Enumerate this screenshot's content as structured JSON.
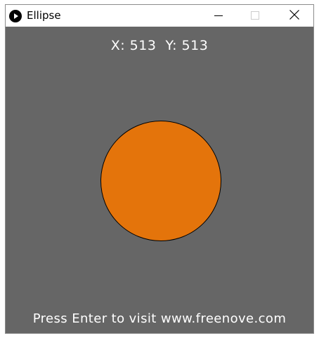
{
  "window": {
    "title": "Ellipse",
    "app_icon": "play-circle-icon",
    "controls": {
      "minimize_icon": "minimize-icon",
      "maximize_icon": "maximize-icon",
      "close_icon": "close-icon"
    }
  },
  "canvas": {
    "background_color": "#666666",
    "coordinates": {
      "x_label": "X:",
      "x_value": "513",
      "y_label": "Y:",
      "y_value": "513"
    },
    "ellipse": {
      "fill_color": "#e4740b",
      "stroke_color": "#000000"
    },
    "footer_text": "Press Enter to visit www.freenove.com"
  }
}
